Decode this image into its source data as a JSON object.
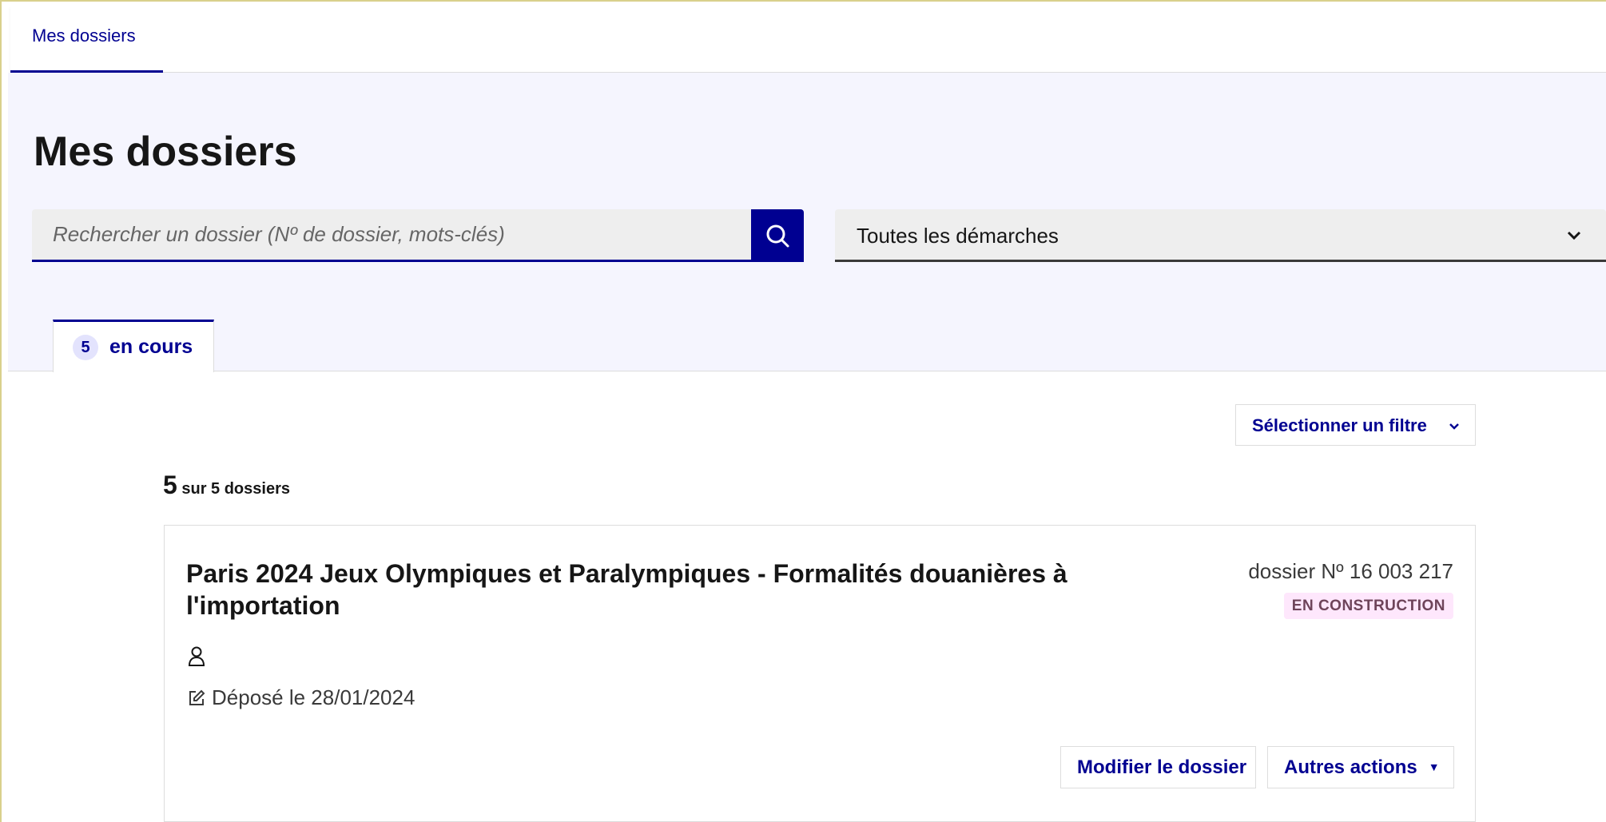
{
  "nav": {
    "item_label": "Mes dossiers"
  },
  "header": {
    "title": "Mes dossiers"
  },
  "search": {
    "placeholder": "Rechercher un dossier (Nº de dossier, mots-clés)",
    "button_icon": "search-icon"
  },
  "procedure_select": {
    "selected": "Toutes les démarches",
    "icon": "chevron-down-icon"
  },
  "tabs": [
    {
      "count": "5",
      "label": "en cours",
      "active": true
    }
  ],
  "filter": {
    "label": "Sélectionner un filtre",
    "icon": "chevron-down-icon"
  },
  "results": {
    "shown": "5",
    "total_text": "sur 5 dossiers"
  },
  "dossiers": [
    {
      "title": "Paris 2024 Jeux Olympiques et Paralympiques - Formalités douanières à l'importation",
      "number_label": "dossier Nº  16 003 217",
      "status": "EN CONSTRUCTION",
      "status_color": "#fee7fc",
      "deposit_text": "Déposé le 28/01/2024",
      "actions": {
        "modify": "Modifier le dossier",
        "other": "Autres actions"
      }
    }
  ],
  "colors": {
    "accent": "#000091",
    "band": "#f5f5fe"
  }
}
